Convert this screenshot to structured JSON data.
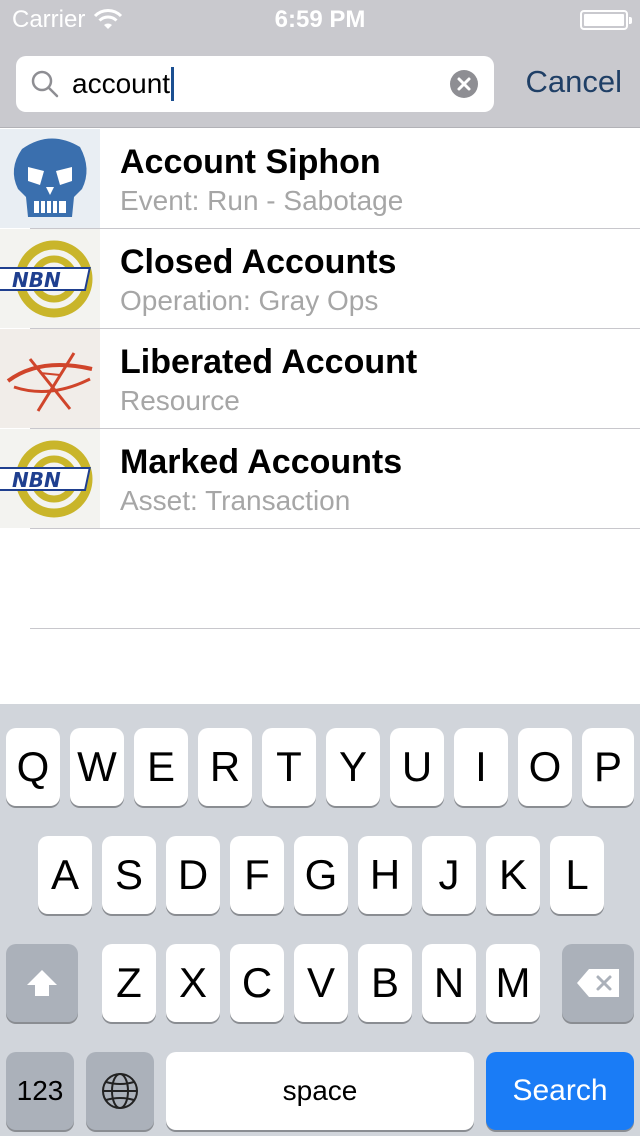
{
  "status_bar": {
    "carrier": "Carrier",
    "time": "6:59 PM"
  },
  "search": {
    "value": "account",
    "cancel_label": "Cancel"
  },
  "results": [
    {
      "title": "Account Siphon",
      "subtitle": "Event: Run - Sabotage",
      "icon": "anarch-skull-icon"
    },
    {
      "title": "Closed Accounts",
      "subtitle": "Operation: Gray Ops",
      "icon": "nbn-logo-icon"
    },
    {
      "title": "Liberated Account",
      "subtitle": "Resource",
      "icon": "criminal-eye-icon"
    },
    {
      "title": "Marked Accounts",
      "subtitle": "Asset: Transaction",
      "icon": "nbn-logo-icon"
    }
  ],
  "keyboard": {
    "row1": [
      "Q",
      "W",
      "E",
      "R",
      "T",
      "Y",
      "U",
      "I",
      "O",
      "P"
    ],
    "row2": [
      "A",
      "S",
      "D",
      "F",
      "G",
      "H",
      "J",
      "K",
      "L"
    ],
    "row3": [
      "Z",
      "X",
      "C",
      "V",
      "B",
      "N",
      "M"
    ],
    "numbers_label": "123",
    "space_label": "space",
    "search_label": "Search"
  },
  "colors": {
    "accent": "#1a7cf6",
    "cancel": "#1f3f66",
    "header": "#c9c9ce",
    "keyboard": "#d1d5db"
  }
}
